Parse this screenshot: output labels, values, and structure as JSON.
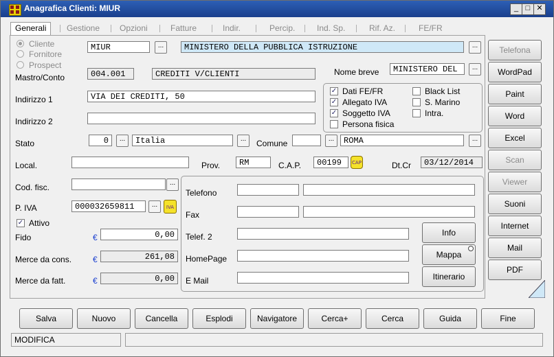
{
  "window": {
    "title": "Anagrafica Clienti: MIUR",
    "minimize": "_",
    "maximize": "□",
    "close": "✕"
  },
  "tabs": [
    "Generali",
    "Gestione",
    "Opzioni",
    "Fatture",
    "Indir.",
    "Percip.",
    "Ind. Sp.",
    "Rif. Az.",
    "FE/FR"
  ],
  "tipo": {
    "cliente": "Cliente",
    "fornitore": "Fornitore",
    "prospect": "Prospect",
    "selected": "Cliente"
  },
  "codice": "MIUR",
  "ragione_sociale": "MINISTERO DELLA PUBBLICA ISTRUZIONE",
  "mastro": {
    "label": "Mastro/Conto",
    "code": "004.001",
    "desc": "CREDITI V/CLIENTI"
  },
  "nome_breve": {
    "label": "Nome breve",
    "value": "MINISTERO DEL"
  },
  "indirizzo1": {
    "label": "Indirizzo 1",
    "value": "VIA DEI CREDITI, 50"
  },
  "indirizzo2": {
    "label": "Indirizzo 2",
    "value": ""
  },
  "flags": {
    "dati_fe": {
      "label": "Dati FE/FR",
      "checked": true
    },
    "allegato_iva": {
      "label": "Allegato IVA",
      "checked": true
    },
    "soggetto_iva": {
      "label": "Soggetto IVA",
      "checked": true
    },
    "persona_fisica": {
      "label": "Persona fisica",
      "checked": false
    },
    "black_list": {
      "label": "Black List",
      "checked": false
    },
    "s_marino": {
      "label": "S. Marino",
      "checked": false
    },
    "intra": {
      "label": "Intra.",
      "checked": false
    }
  },
  "stato": {
    "label": "Stato",
    "code": "0",
    "name": "Italia"
  },
  "comune": {
    "label": "Comune",
    "code": "",
    "name": "ROMA"
  },
  "local": {
    "label": "Local.",
    "value": ""
  },
  "prov": {
    "label": "Prov.",
    "value": "RM"
  },
  "cap": {
    "label": "C.A.P.",
    "value": "00199",
    "icon": "CAP"
  },
  "dtcr": {
    "label": "Dt.Cr",
    "value": "03/12/2014"
  },
  "cod_fisc": {
    "label": "Cod. fisc.",
    "value": ""
  },
  "piva": {
    "label": "P. IVA",
    "value": "000032659811",
    "icon": "IVA"
  },
  "attivo": {
    "label": "Attivo",
    "checked": true
  },
  "fido": {
    "label": "Fido",
    "value": "0,00"
  },
  "merce_cons": {
    "label": "Merce da cons.",
    "value": "261,08"
  },
  "merce_fatt": {
    "label": "Merce da fatt.",
    "value": "0,00"
  },
  "currency": "€",
  "contacts": {
    "telefono": {
      "label": "Telefono",
      "value1": "",
      "value2": ""
    },
    "fax": {
      "label": "Fax",
      "value1": "",
      "value2": ""
    },
    "telef2": {
      "label": "Telef. 2",
      "value": ""
    },
    "homepage": {
      "label": "HomePage",
      "value": ""
    },
    "email": {
      "label": "E Mail",
      "value": ""
    }
  },
  "info_buttons": [
    "Info",
    "Mappa",
    "Itinerario"
  ],
  "side_buttons": [
    {
      "label": "Telefona",
      "enabled": false
    },
    {
      "label": "WordPad",
      "enabled": true
    },
    {
      "label": "Paint",
      "enabled": true
    },
    {
      "label": "Word",
      "enabled": true
    },
    {
      "label": "Excel",
      "enabled": true
    },
    {
      "label": "Scan",
      "enabled": false
    },
    {
      "label": "Viewer",
      "enabled": false
    },
    {
      "label": "Suoni",
      "enabled": true
    },
    {
      "label": "Internet",
      "enabled": true
    },
    {
      "label": "Mail",
      "enabled": true
    },
    {
      "label": "PDF",
      "enabled": true
    }
  ],
  "bottom_buttons": [
    "Salva",
    "Nuovo",
    "Cancella",
    "Esplodi",
    "Navigatore",
    "Cerca+",
    "Cerca",
    "Guida",
    "Fine"
  ],
  "status": {
    "mode": "MODIFICA",
    "message": ""
  },
  "colors": {
    "title_bar": "#1f4a9c",
    "highlight_field": "#cfe8f7",
    "euro": "#1a3fd0"
  }
}
